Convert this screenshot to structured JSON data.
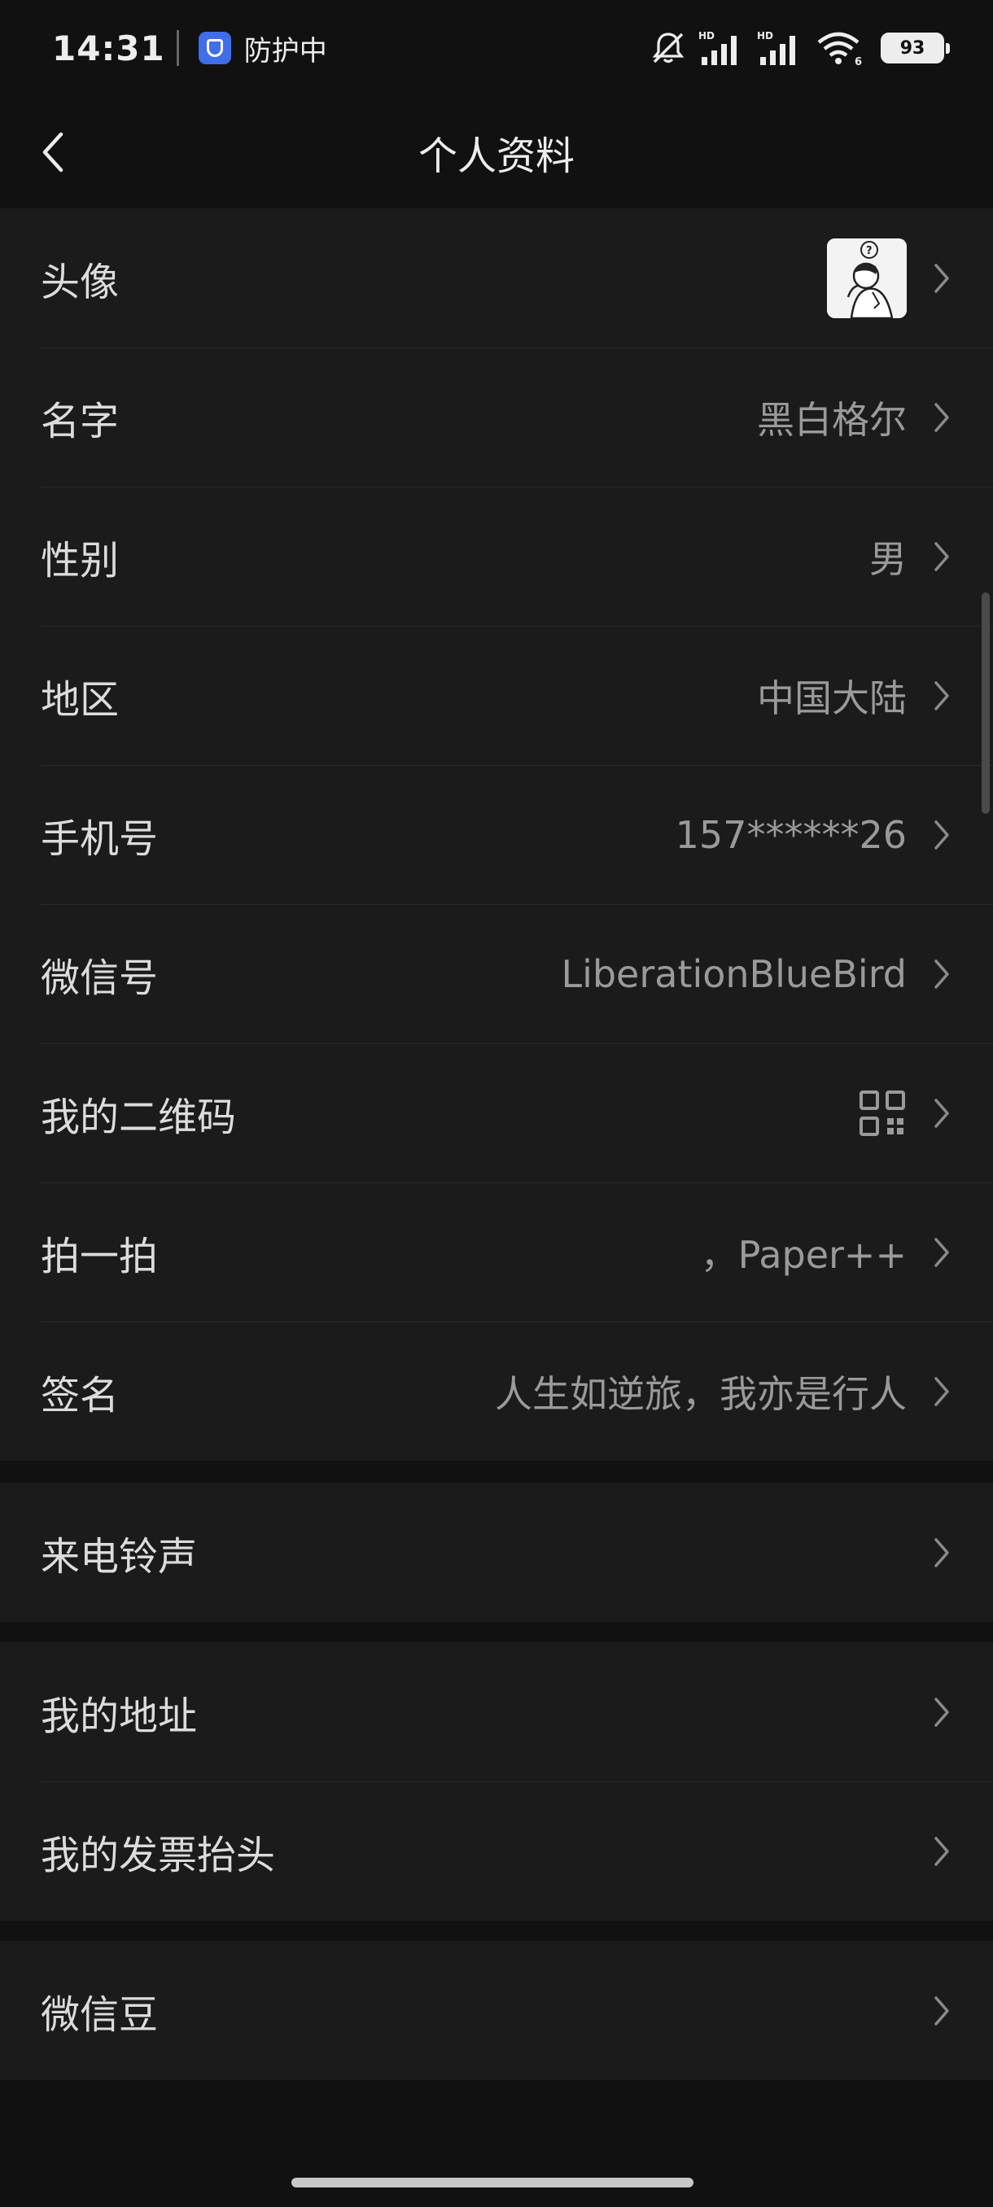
{
  "status_bar": {
    "time": "14:31",
    "protect_label": "防护中",
    "battery": "93",
    "signal_tag_1": "HD",
    "signal_tag_2": "HD",
    "wifi_tag": "6"
  },
  "header": {
    "title": "个人资料"
  },
  "profile": {
    "avatar_label": "头像",
    "name_label": "名字",
    "name_value": "黑白格尔",
    "gender_label": "性别",
    "gender_value": "男",
    "region_label": "地区",
    "region_value": "中国大陆",
    "phone_label": "手机号",
    "phone_value": "157******26",
    "wechat_id_label": "微信号",
    "wechat_id_value": "LiberationBlueBird",
    "qr_label": "我的二维码",
    "pat_label": "拍一拍",
    "pat_value": "，Paper++",
    "signature_label": "签名",
    "signature_value": "人生如逆旅，我亦是行人"
  },
  "ringtone": {
    "label": "来电铃声"
  },
  "addresses": {
    "address_label": "我的地址",
    "invoice_label": "我的发票抬头"
  },
  "beans": {
    "label": "微信豆"
  },
  "colors": {
    "background": "#111111",
    "row_background": "#1b1b1b",
    "label_text": "#dcdcdc",
    "value_text": "#9a9a9a"
  }
}
